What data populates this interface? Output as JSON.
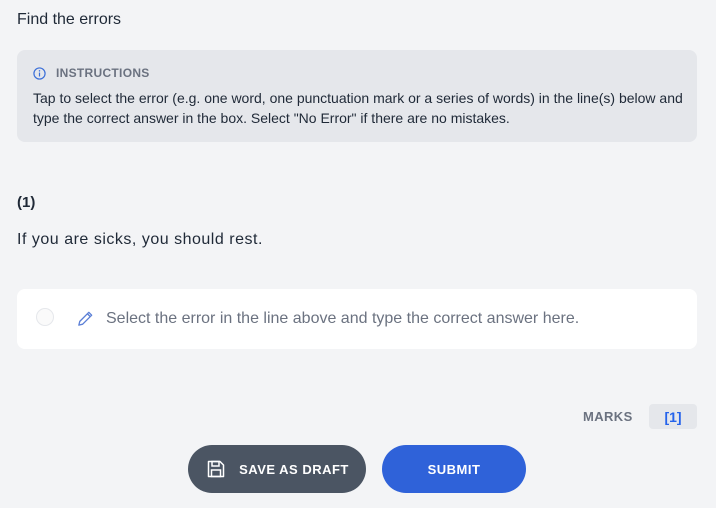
{
  "page": {
    "title": "Find the errors"
  },
  "instructions": {
    "heading": "INSTRUCTIONS",
    "icon": "info-icon",
    "text": "Tap to select the error (e.g. one word, one punctuation mark or a series of words) in the line(s) below and type the correct answer in the box. Select \"No Error\" if there are no mistakes."
  },
  "question": {
    "number": "(1)",
    "tokens": [
      "If",
      "you",
      "are",
      "sicks,",
      "you",
      "should",
      "rest."
    ]
  },
  "answer": {
    "placeholder": "Select the error in the line above and type the correct answer here.",
    "value": "",
    "no_error_selected": false
  },
  "marks": {
    "label": "MARKS",
    "value": "[1]"
  },
  "actions": {
    "save_draft_label": "SAVE AS DRAFT",
    "submit_label": "SUBMIT"
  },
  "colors": {
    "accent": "#2f62d9",
    "draft_button": "#4b5563",
    "marks_text": "#2563eb",
    "panel_bg": "#e5e7eb",
    "page_bg": "#f3f4f6"
  }
}
